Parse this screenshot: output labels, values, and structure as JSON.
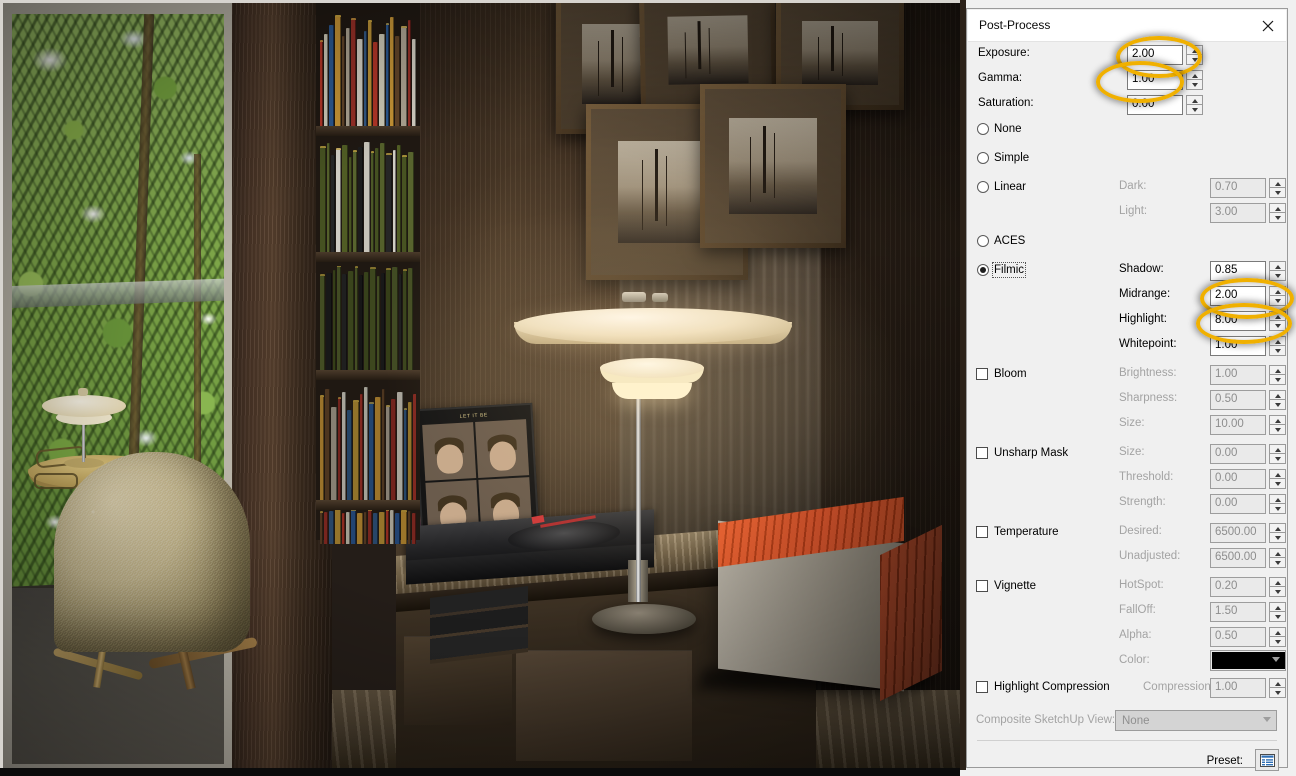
{
  "window": {
    "title": "Post-Process",
    "close_icon": "close-icon"
  },
  "top_fields": [
    {
      "label": "Exposure:",
      "value": "2.00",
      "disabled": false,
      "highlighted": true
    },
    {
      "label": "Gamma:",
      "value": "1.00",
      "disabled": false,
      "highlighted": true
    },
    {
      "label": "Saturation:",
      "value": "0.00",
      "disabled": false,
      "highlighted": false
    }
  ],
  "tonemap_options": [
    {
      "label": "None",
      "selected": false
    },
    {
      "label": "Simple",
      "selected": false
    },
    {
      "label": "Linear",
      "selected": false
    },
    {
      "label": "ACES",
      "selected": false
    },
    {
      "label": "Filmic",
      "selected": true,
      "focused": true
    }
  ],
  "linear_fields": [
    {
      "label": "Dark:",
      "value": "0.70",
      "disabled": true
    },
    {
      "label": "Light:",
      "value": "3.00",
      "disabled": true
    }
  ],
  "filmic_fields": [
    {
      "label": "Shadow:",
      "value": "0.85",
      "disabled": false,
      "highlighted": false
    },
    {
      "label": "Midrange:",
      "value": "2.00",
      "disabled": false,
      "highlighted": true
    },
    {
      "label": "Highlight:",
      "value": "8.00",
      "disabled": false,
      "highlighted": true
    },
    {
      "label": "Whitepoint:",
      "value": "1.00",
      "disabled": false,
      "highlighted": false
    }
  ],
  "effects": [
    {
      "name": "Bloom",
      "checked": false,
      "fields": [
        {
          "label": "Brightness:",
          "value": "1.00",
          "disabled": true
        },
        {
          "label": "Sharpness:",
          "value": "0.50",
          "disabled": true
        },
        {
          "label": "Size:",
          "value": "10.00",
          "disabled": true
        }
      ]
    },
    {
      "name": "Unsharp Mask",
      "checked": false,
      "fields": [
        {
          "label": "Size:",
          "value": "0.00",
          "disabled": true
        },
        {
          "label": "Threshold:",
          "value": "0.00",
          "disabled": true
        },
        {
          "label": "Strength:",
          "value": "0.00",
          "disabled": true
        }
      ]
    },
    {
      "name": "Temperature",
      "checked": false,
      "fields": [
        {
          "label": "Desired:",
          "value": "6500.00",
          "disabled": true
        },
        {
          "label": "Unadjusted:",
          "value": "6500.00",
          "disabled": true
        }
      ]
    },
    {
      "name": "Vignette",
      "checked": false,
      "fields": [
        {
          "label": "HotSpot:",
          "value": "0.20",
          "disabled": true
        },
        {
          "label": "FallOff:",
          "value": "1.50",
          "disabled": true
        },
        {
          "label": "Alpha:",
          "value": "0.50",
          "disabled": true
        }
      ]
    },
    {
      "name": "Highlight Compression",
      "checked": false,
      "fields": [
        {
          "label": "Compression:",
          "value": "1.00",
          "disabled": true
        }
      ]
    }
  ],
  "vignette_color": {
    "label": "Color:",
    "value": "#000000",
    "disabled": true
  },
  "composite": {
    "label": "Composite SketchUp View:",
    "value": "None",
    "disabled": true
  },
  "preset": {
    "label": "Preset:",
    "icon": "preset-list-icon"
  },
  "colors": {
    "annotation": "#f0b000",
    "panel_bg": "#f0f0f0",
    "titlebar_bg": "#ffffff",
    "disabled_text": "#a3a3a3"
  },
  "render": {
    "album_title": "LET IT BE"
  }
}
